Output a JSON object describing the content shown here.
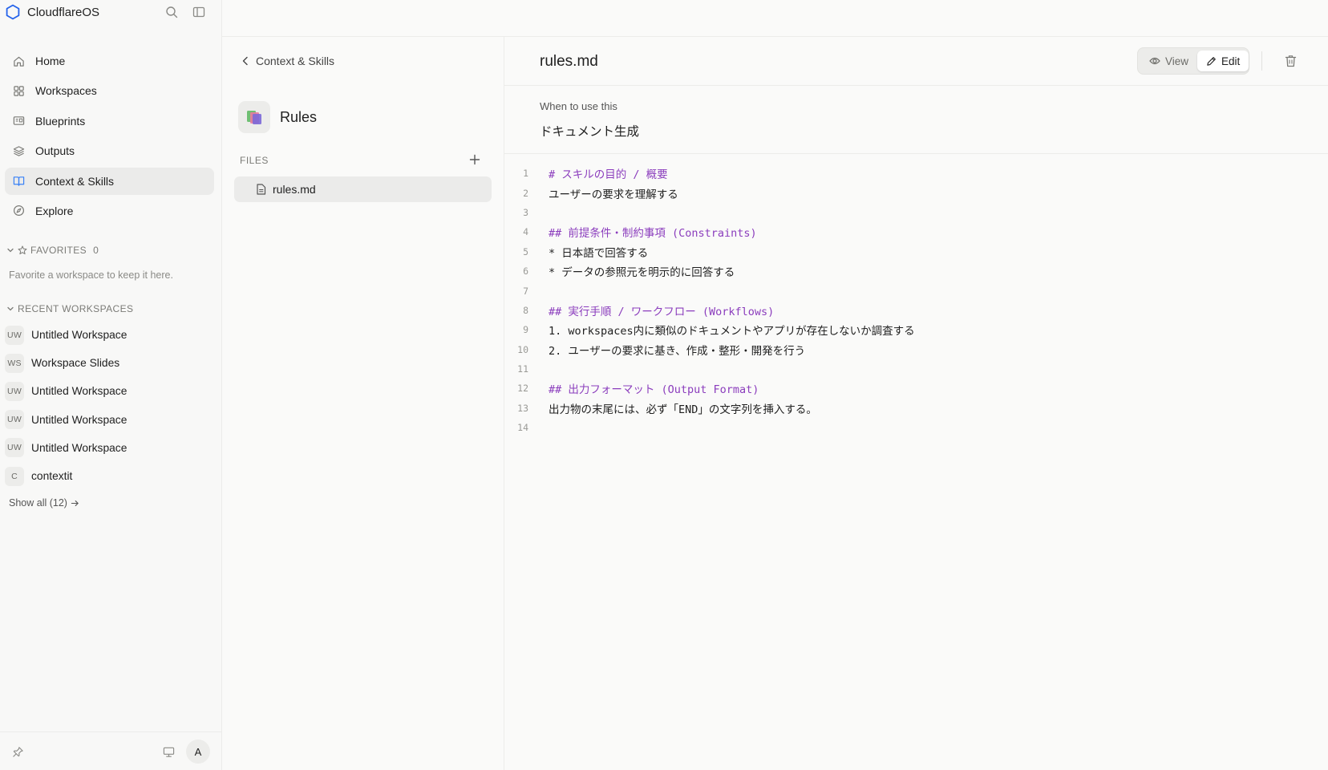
{
  "app": {
    "name": "CloudflareOS",
    "brand_color": "#2563eb",
    "accent_color": "#3b82f6",
    "heading_color": "#8b3dbd"
  },
  "sidebar": {
    "nav": [
      {
        "label": "Home",
        "icon": "home-icon"
      },
      {
        "label": "Workspaces",
        "icon": "grid-icon"
      },
      {
        "label": "Blueprints",
        "icon": "blueprint-icon"
      },
      {
        "label": "Outputs",
        "icon": "layers-icon"
      },
      {
        "label": "Context & Skills",
        "icon": "book-icon",
        "active": true
      },
      {
        "label": "Explore",
        "icon": "compass-icon"
      }
    ],
    "favorites": {
      "label": "FAVORITES",
      "count": "0",
      "hint": "Favorite a workspace to keep it here."
    },
    "recent": {
      "label": "RECENT WORKSPACES",
      "items": [
        {
          "badge": "UW",
          "name": "Untitled Workspace"
        },
        {
          "badge": "WS",
          "name": "Workspace Slides"
        },
        {
          "badge": "UW",
          "name": "Untitled Workspace"
        },
        {
          "badge": "UW",
          "name": "Untitled Workspace"
        },
        {
          "badge": "UW",
          "name": "Untitled Workspace"
        },
        {
          "badge": "C",
          "name": "contextit"
        }
      ],
      "show_all": "Show all (12)"
    },
    "footer": {
      "avatar": "A"
    }
  },
  "middle": {
    "back_label": "Context & Skills",
    "skill_title": "Rules",
    "files_label": "FILES",
    "files": [
      {
        "name": "rules.md",
        "active": true
      }
    ]
  },
  "editor": {
    "file_title": "rules.md",
    "view_label": "View",
    "edit_label": "Edit",
    "mode": "edit",
    "when_label": "When to use this",
    "when_value": "ドキュメント生成",
    "lines": [
      {
        "n": "1",
        "text": "# スキルの目的 / 概要",
        "heading": true
      },
      {
        "n": "2",
        "text": "ユーザーの要求を理解する",
        "heading": false
      },
      {
        "n": "3",
        "text": "",
        "heading": false
      },
      {
        "n": "4",
        "text": "## 前提条件・制約事項 (Constraints)",
        "heading": true
      },
      {
        "n": "5",
        "text": "* 日本語で回答する",
        "heading": false
      },
      {
        "n": "6",
        "text": "* データの参照元を明示的に回答する",
        "heading": false
      },
      {
        "n": "7",
        "text": "",
        "heading": false
      },
      {
        "n": "8",
        "text": "## 実行手順 / ワークフロー (Workflows)",
        "heading": true
      },
      {
        "n": "9",
        "text": "1. workspaces内に類似のドキュメントやアプリが存在しないか調査する",
        "heading": false
      },
      {
        "n": "10",
        "text": "2. ユーザーの要求に基き、作成・整形・開発を行う",
        "heading": false
      },
      {
        "n": "11",
        "text": "",
        "heading": false
      },
      {
        "n": "12",
        "text": "## 出力フォーマット (Output Format)",
        "heading": true
      },
      {
        "n": "13",
        "text": "出力物の末尾には、必ず「END」の文字列を挿入する。",
        "heading": false
      },
      {
        "n": "14",
        "text": "",
        "heading": false
      }
    ]
  }
}
